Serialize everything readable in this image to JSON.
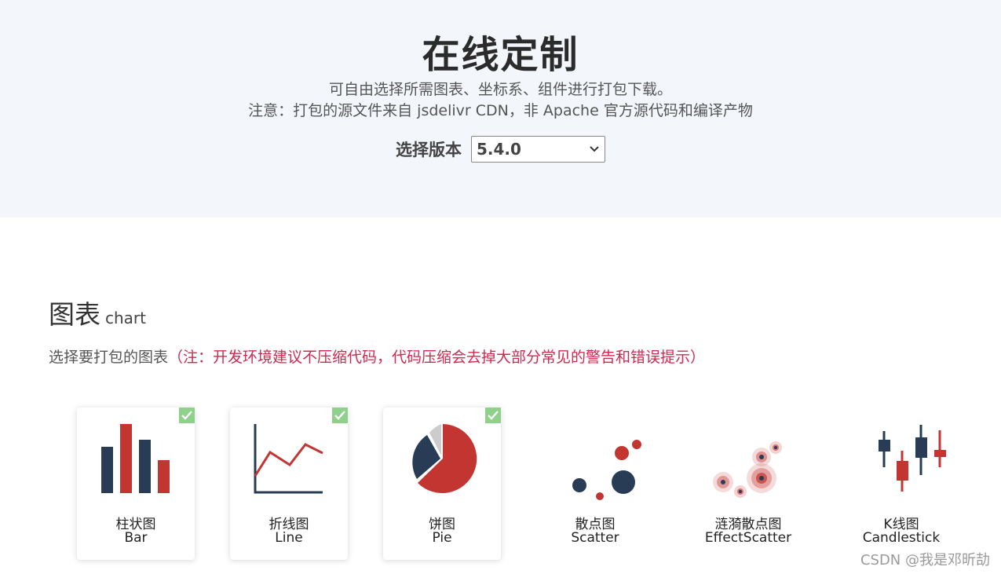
{
  "header": {
    "title": "在线定制",
    "line1": "可自由选择所需图表、坐标系、组件进行打包下载。",
    "line2": "注意：打包的源文件来自 jsdelivr CDN，非 Apache 官方源代码和编译产物",
    "version_label": "选择版本",
    "version_value": "5.4.0"
  },
  "section": {
    "title_zh": "图表",
    "title_en": "chart",
    "desc": "选择要打包的图表",
    "note": "（注：开发环境建议不压缩代码，代码压缩会去掉大部分常见的警告和错误提示）"
  },
  "charts": [
    {
      "zh": "柱状图",
      "en": "Bar",
      "selected": true,
      "icon": "bar-chart-icon"
    },
    {
      "zh": "折线图",
      "en": "Line",
      "selected": true,
      "icon": "line-chart-icon"
    },
    {
      "zh": "饼图",
      "en": "Pie",
      "selected": true,
      "icon": "pie-chart-icon"
    },
    {
      "zh": "散点图",
      "en": "Scatter",
      "selected": false,
      "icon": "scatter-chart-icon"
    },
    {
      "zh": "涟漪散点图",
      "en": "EffectScatter",
      "selected": false,
      "icon": "effect-scatter-chart-icon"
    },
    {
      "zh": "K线图",
      "en": "Candlestick",
      "selected": false,
      "icon": "candlestick-chart-icon"
    }
  ],
  "colors": {
    "dark": "#293c55",
    "red": "#c23531",
    "check": "#8fd18a",
    "note": "#d12850"
  },
  "watermark": "CSDN @我是邓昕劼"
}
